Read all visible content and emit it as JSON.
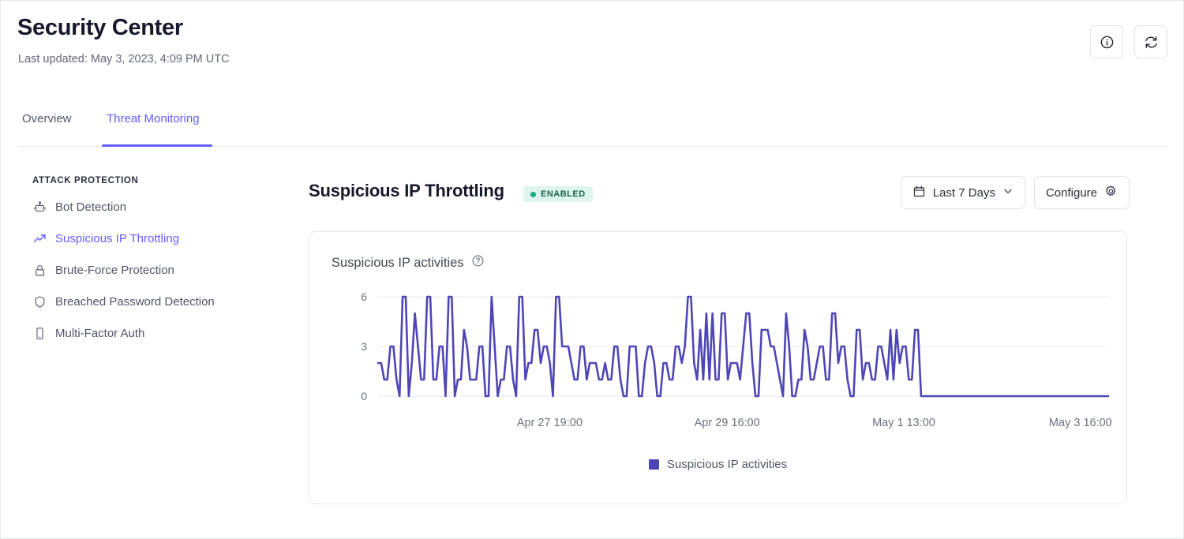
{
  "header": {
    "title": "Security Center",
    "subtitle": "Last updated: May 3, 2023, 4:09 PM UTC",
    "actions": [
      {
        "name": "info-icon",
        "label": "Info"
      },
      {
        "name": "refresh-icon",
        "label": "Refresh"
      }
    ]
  },
  "tabs": [
    {
      "label": "Overview",
      "active": false
    },
    {
      "label": "Threat Monitoring",
      "active": true
    }
  ],
  "sidebar": {
    "heading": "ATTACK PROTECTION",
    "items": [
      {
        "label": "Bot Detection",
        "icon": "robot-icon",
        "active": false
      },
      {
        "label": "Suspicious IP Throttling",
        "icon": "trending-up-icon",
        "active": true
      },
      {
        "label": "Brute-Force Protection",
        "icon": "lock-icon",
        "active": false
      },
      {
        "label": "Breached Password Detection",
        "icon": "shield-icon",
        "active": false
      },
      {
        "label": "Multi-Factor Auth",
        "icon": "mobile-icon",
        "active": false
      }
    ]
  },
  "panel": {
    "title": "Suspicious IP Throttling",
    "status_badge": "ENABLED",
    "date_range": "Last 7 Days",
    "configure_label": "Configure"
  },
  "card": {
    "title": "Suspicious IP activities",
    "help_icon": "question-circle-icon"
  },
  "colors": {
    "accent": "#635dff",
    "series": "#4f46b5",
    "badge_bg": "#ddf5ec",
    "badge_text": "#17624d",
    "badge_dot": "#16a97f",
    "grid": "#eef0f3",
    "axis_text": "#6b7180"
  },
  "chart_data": {
    "type": "line",
    "title": "Suspicious IP activities",
    "xlabel": "",
    "ylabel": "",
    "ylim": [
      0,
      6
    ],
    "yticks": [
      0,
      3,
      6
    ],
    "grid": true,
    "legend_position": "bottom",
    "xtick_labels": [
      "Apr 27 19:00",
      "Apr 29 16:00",
      "May 1 13:00",
      "May 3 16:00"
    ],
    "xtick_positions": [
      0.235,
      0.478,
      0.72,
      0.962
    ],
    "series": [
      {
        "name": "Suspicious IP activities",
        "color": "#4f46b5",
        "values": [
          2,
          2,
          1,
          1,
          3,
          3,
          1,
          0,
          6,
          6,
          0,
          2,
          5,
          3,
          1,
          1,
          6,
          6,
          1,
          1,
          3,
          3,
          0,
          6,
          6,
          0,
          1,
          1,
          4,
          3,
          1,
          1,
          1,
          3,
          3,
          0,
          0,
          6,
          3,
          0,
          1,
          1,
          3,
          3,
          1,
          0,
          6,
          6,
          1,
          2,
          2,
          4,
          4,
          2,
          3,
          3,
          2,
          0,
          6,
          6,
          3,
          3,
          3,
          2,
          1,
          1,
          3,
          3,
          1,
          2,
          2,
          2,
          1,
          1,
          2,
          1,
          1,
          3,
          3,
          1,
          0,
          0,
          3,
          3,
          3,
          0,
          0,
          2,
          3,
          3,
          2,
          0,
          0,
          2,
          2,
          1,
          1,
          3,
          3,
          2,
          3,
          6,
          6,
          2,
          1,
          4,
          1,
          5,
          1,
          5,
          1,
          1,
          5,
          5,
          1,
          2,
          2,
          2,
          1,
          3,
          5,
          5,
          2,
          0,
          0,
          4,
          4,
          4,
          3,
          3,
          2,
          1,
          0,
          5,
          3,
          0,
          0,
          1,
          1,
          4,
          3,
          1,
          1,
          2,
          3,
          3,
          1,
          1,
          5,
          5,
          2,
          3,
          3,
          1,
          0,
          0,
          4,
          4,
          1,
          2,
          2,
          1,
          1,
          3,
          3,
          2,
          1,
          4,
          1,
          4,
          2,
          3,
          3,
          1,
          1,
          4,
          4,
          0,
          0,
          0,
          0,
          0,
          0,
          0,
          0,
          0,
          0,
          0,
          0,
          0,
          0,
          0,
          0,
          0,
          0,
          0,
          0,
          0,
          0,
          0,
          0,
          0,
          0,
          0,
          0,
          0,
          0,
          0,
          0,
          0,
          0,
          0,
          0,
          0,
          0,
          0,
          0,
          0,
          0,
          0,
          0,
          0,
          0,
          0,
          0,
          0,
          0,
          0,
          0,
          0,
          0,
          0,
          0,
          0,
          0,
          0,
          0,
          0,
          0
        ]
      }
    ],
    "legend": [
      "Suspicious IP activities"
    ]
  }
}
